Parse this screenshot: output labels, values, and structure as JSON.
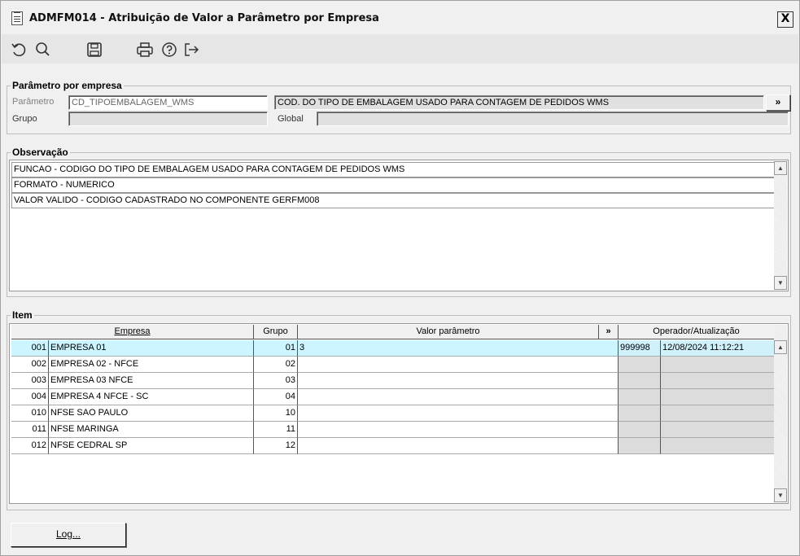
{
  "window": {
    "title": "ADMFM014 - Atribuição de Valor a Parâmetro por Empresa",
    "close_label": "X"
  },
  "toolbar": {
    "icons": [
      "undo-icon",
      "search-icon",
      "save-icon",
      "print-icon",
      "help-icon",
      "exit-icon"
    ]
  },
  "parametro_group": {
    "legend": "Parâmetro por empresa",
    "parametro_label": "Parâmetro",
    "parametro_value": "CD_TIPOEMBALAGEM_WMS",
    "descricao_value": "COD. DO TIPO DE EMBALAGEM USADO PARA CONTAGEM DE PEDIDOS WMS",
    "more_label": "»",
    "grupo_label": "Grupo",
    "grupo_value": "",
    "global_label": "Global",
    "global_value": ""
  },
  "observacao": {
    "legend": "Observação",
    "lines": [
      "FUNCAO - CODIGO DO TIPO DE EMBALAGEM USADO PARA CONTAGEM DE PEDIDOS WMS",
      "FORMATO - NUMERICO",
      "VALOR VALIDO - CODIGO CADASTRADO NO COMPONENTE GERFM008"
    ]
  },
  "item": {
    "legend": "Item",
    "headers": {
      "empresa": "Empresa",
      "grupo": "Grupo",
      "valor": "Valor parâmetro",
      "more": "»",
      "operador": "Operador/Atualização"
    },
    "rows": [
      {
        "code": "001",
        "empresa": "EMPRESA 01",
        "grupo": "01",
        "valor": "3",
        "operador": "999998",
        "atualizacao": "12/08/2024 11:12:21"
      },
      {
        "code": "002",
        "empresa": "EMPRESA 02 - NFCE",
        "grupo": "02",
        "valor": "",
        "operador": "",
        "atualizacao": ""
      },
      {
        "code": "003",
        "empresa": "EMPRESA 03 NFCE",
        "grupo": "03",
        "valor": "",
        "operador": "",
        "atualizacao": ""
      },
      {
        "code": "004",
        "empresa": "EMPRESA 4 NFCE - SC",
        "grupo": "04",
        "valor": "",
        "operador": "",
        "atualizacao": ""
      },
      {
        "code": "010",
        "empresa": "NFSE SAO PAULO",
        "grupo": "10",
        "valor": "",
        "operador": "",
        "atualizacao": ""
      },
      {
        "code": "011",
        "empresa": "NFSE MARINGA",
        "grupo": "11",
        "valor": "",
        "operador": "",
        "atualizacao": ""
      },
      {
        "code": "012",
        "empresa": "NFSE CEDRAL SP",
        "grupo": "12",
        "valor": "",
        "operador": "",
        "atualizacao": ""
      }
    ]
  },
  "footer": {
    "log_label": "Log..."
  }
}
